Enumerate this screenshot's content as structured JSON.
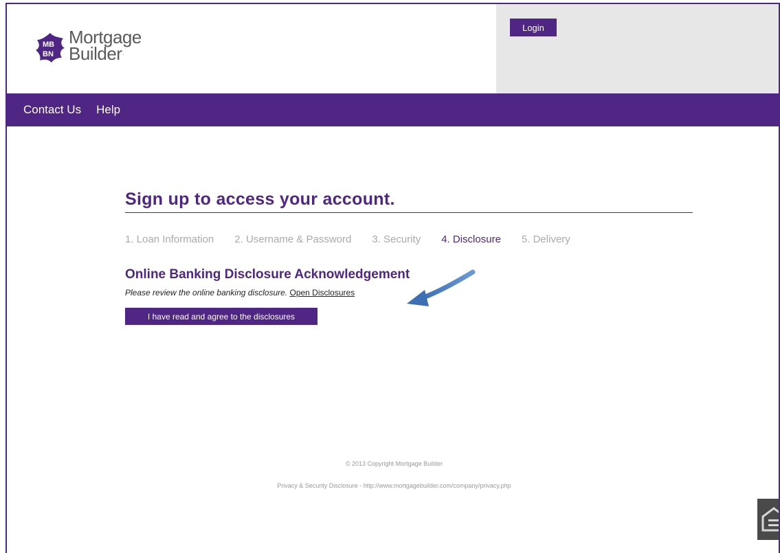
{
  "header": {
    "logo_line1": "Mortgage",
    "logo_line2": "Builder",
    "login_label": "Login"
  },
  "nav": {
    "items": [
      {
        "label": "Contact Us"
      },
      {
        "label": "Help"
      }
    ]
  },
  "main": {
    "title": "Sign up to access your account.",
    "steps": [
      {
        "label": "1. Loan Information",
        "active": false
      },
      {
        "label": "2. Username & Password",
        "active": false
      },
      {
        "label": "3. Security",
        "active": false
      },
      {
        "label": "4. Disclosure",
        "active": true
      },
      {
        "label": "5. Delivery",
        "active": false
      }
    ],
    "section_title": "Online Banking Disclosure Acknowledgement",
    "instruction_text": "Please review the online banking disclosure.",
    "open_link": "Open Disclosures",
    "agree_button": "I have read and agree to the disclosures"
  },
  "footer": {
    "copyright": "© 2013 Copyright Mortgage Builder",
    "privacy": "Privacy & Security Disclosure - http://www.mortgagebuilder.com/company/privacy.php"
  },
  "colors": {
    "brand_purple": "#4f2683",
    "arrow_blue": "#4a7fc1",
    "login_panel_bg": "#e7e7e8"
  },
  "icons": {
    "logo": "mortgage-builder-logo-icon",
    "arrow": "annotation-arrow-icon",
    "equal_housing": "equal-housing-lender-icon"
  }
}
